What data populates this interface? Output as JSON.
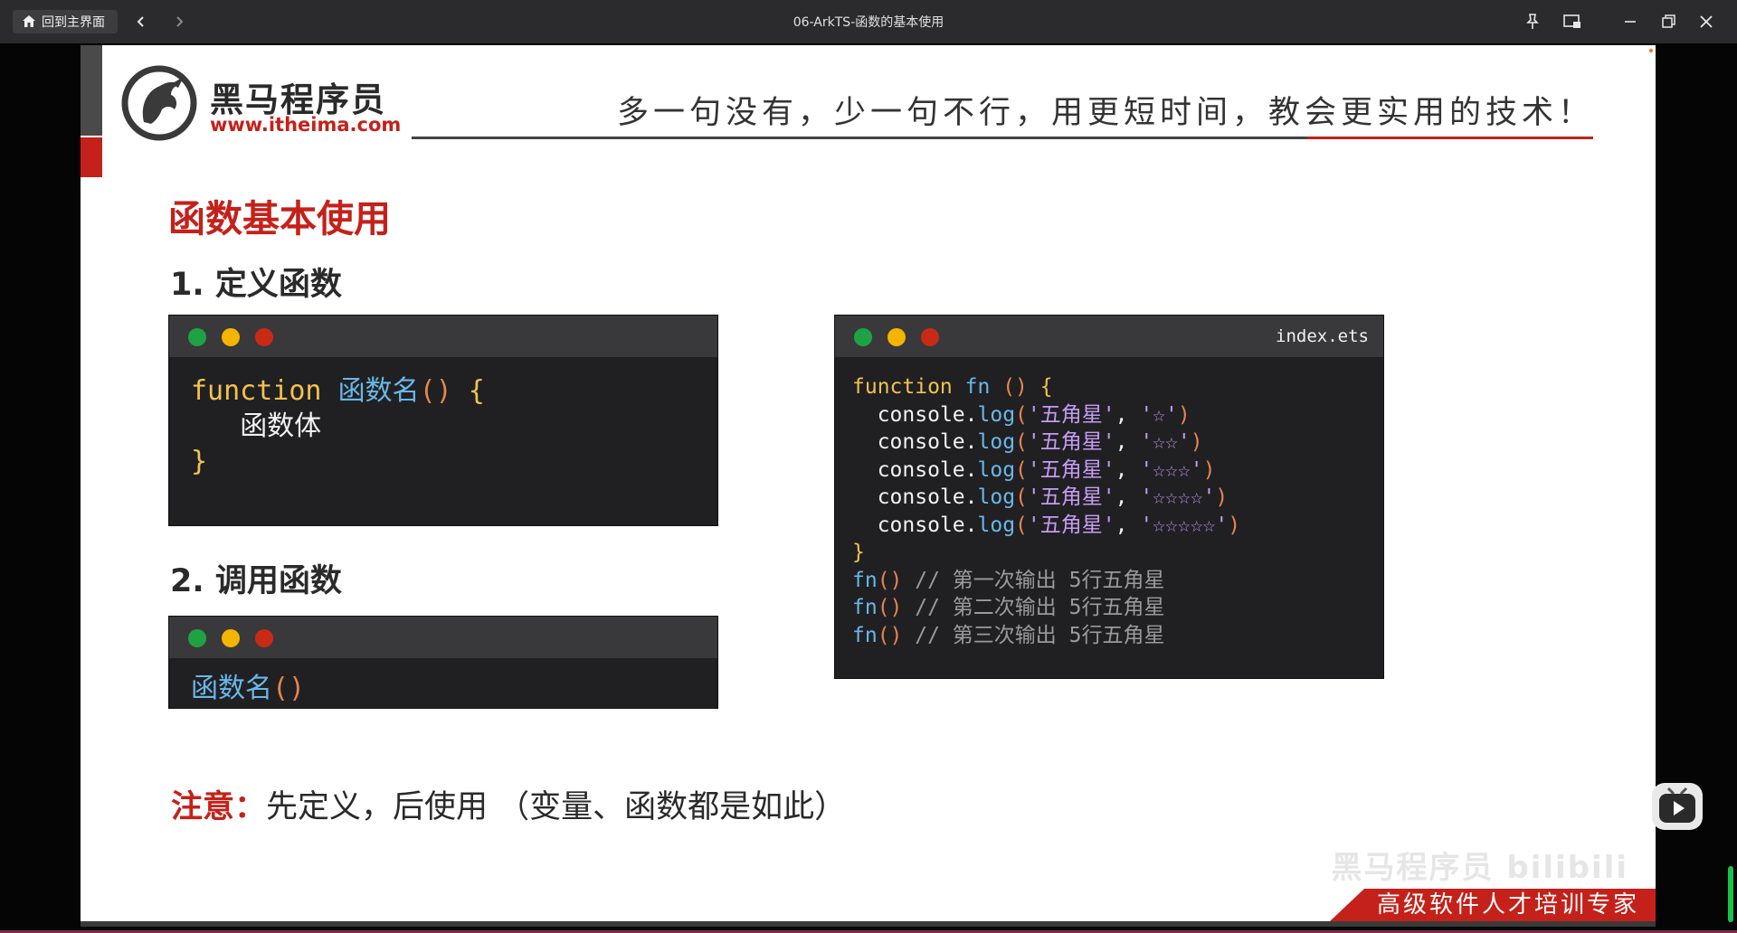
{
  "titlebar": {
    "home_label": "回到主界面",
    "window_title": "06-ArkTS-函数的基本使用"
  },
  "slide": {
    "brand_cn": "黑马程序员",
    "brand_url": "www.itheima.com",
    "slogan": "多一句没有，少一句不行，用更短时间，教会更实用的技术！",
    "title": "函数基本使用",
    "section1": "1. 定义函数",
    "section2": "2. 调用函数",
    "code_def": {
      "line1_kw": "function",
      "line1_name": "函数名",
      "line1_paren": "()",
      "line1_brace": "{",
      "line2": "函数体",
      "line3": "}"
    },
    "code_call": {
      "name": "函数名",
      "paren": "()"
    },
    "example": {
      "filename": "index.ets",
      "kw": "function",
      "fn_name": "fn",
      "paren": "()",
      "open_brace": "{",
      "close_brace": "}",
      "console": "console",
      "log": "log",
      "label": "'五角星'",
      "stars": [
        "'☆'",
        "'☆☆'",
        "'☆☆☆'",
        "'☆☆☆☆'",
        "'☆☆☆☆☆'"
      ],
      "calls": [
        {
          "call": "fn",
          "paren": "()",
          "comment": "// 第一次输出 5行五角星"
        },
        {
          "call": "fn",
          "paren": "()",
          "comment": "// 第二次输出 5行五角星"
        },
        {
          "call": "fn",
          "paren": "()",
          "comment": "// 第三次输出 5行五角星"
        }
      ]
    },
    "note_label": "注意：",
    "note_text": "先定义，后使用 （变量、函数都是如此）",
    "banner": "高级软件人才培训专家",
    "watermark": "黑马程序员 bilibili"
  }
}
